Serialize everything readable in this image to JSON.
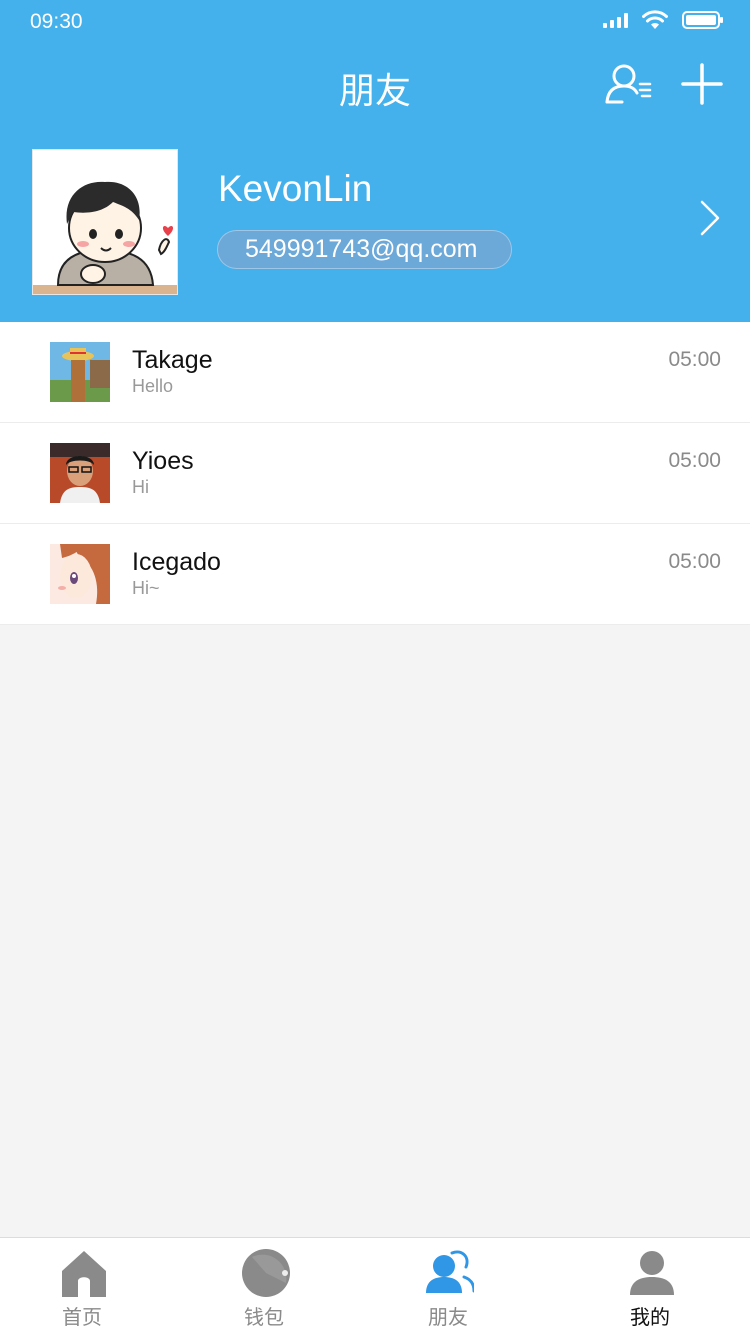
{
  "status_bar": {
    "time": "09:30"
  },
  "nav": {
    "title": "朋友"
  },
  "profile": {
    "name": "KevonLin",
    "email": "549991743@qq.com"
  },
  "friends": [
    {
      "name": "Takage",
      "message": "Hello",
      "time": "05:00"
    },
    {
      "name": "Yioes",
      "message": "Hi",
      "time": "05:00"
    },
    {
      "name": "Icegado",
      "message": "Hi~",
      "time": "05:00"
    }
  ],
  "tabs": [
    {
      "label": "首页"
    },
    {
      "label": "钱包"
    },
    {
      "label": "朋友"
    },
    {
      "label": "我的"
    }
  ],
  "colors": {
    "brand": "#45b1ec",
    "active_tab": "#2f97e6",
    "inactive_tab": "#888888"
  }
}
